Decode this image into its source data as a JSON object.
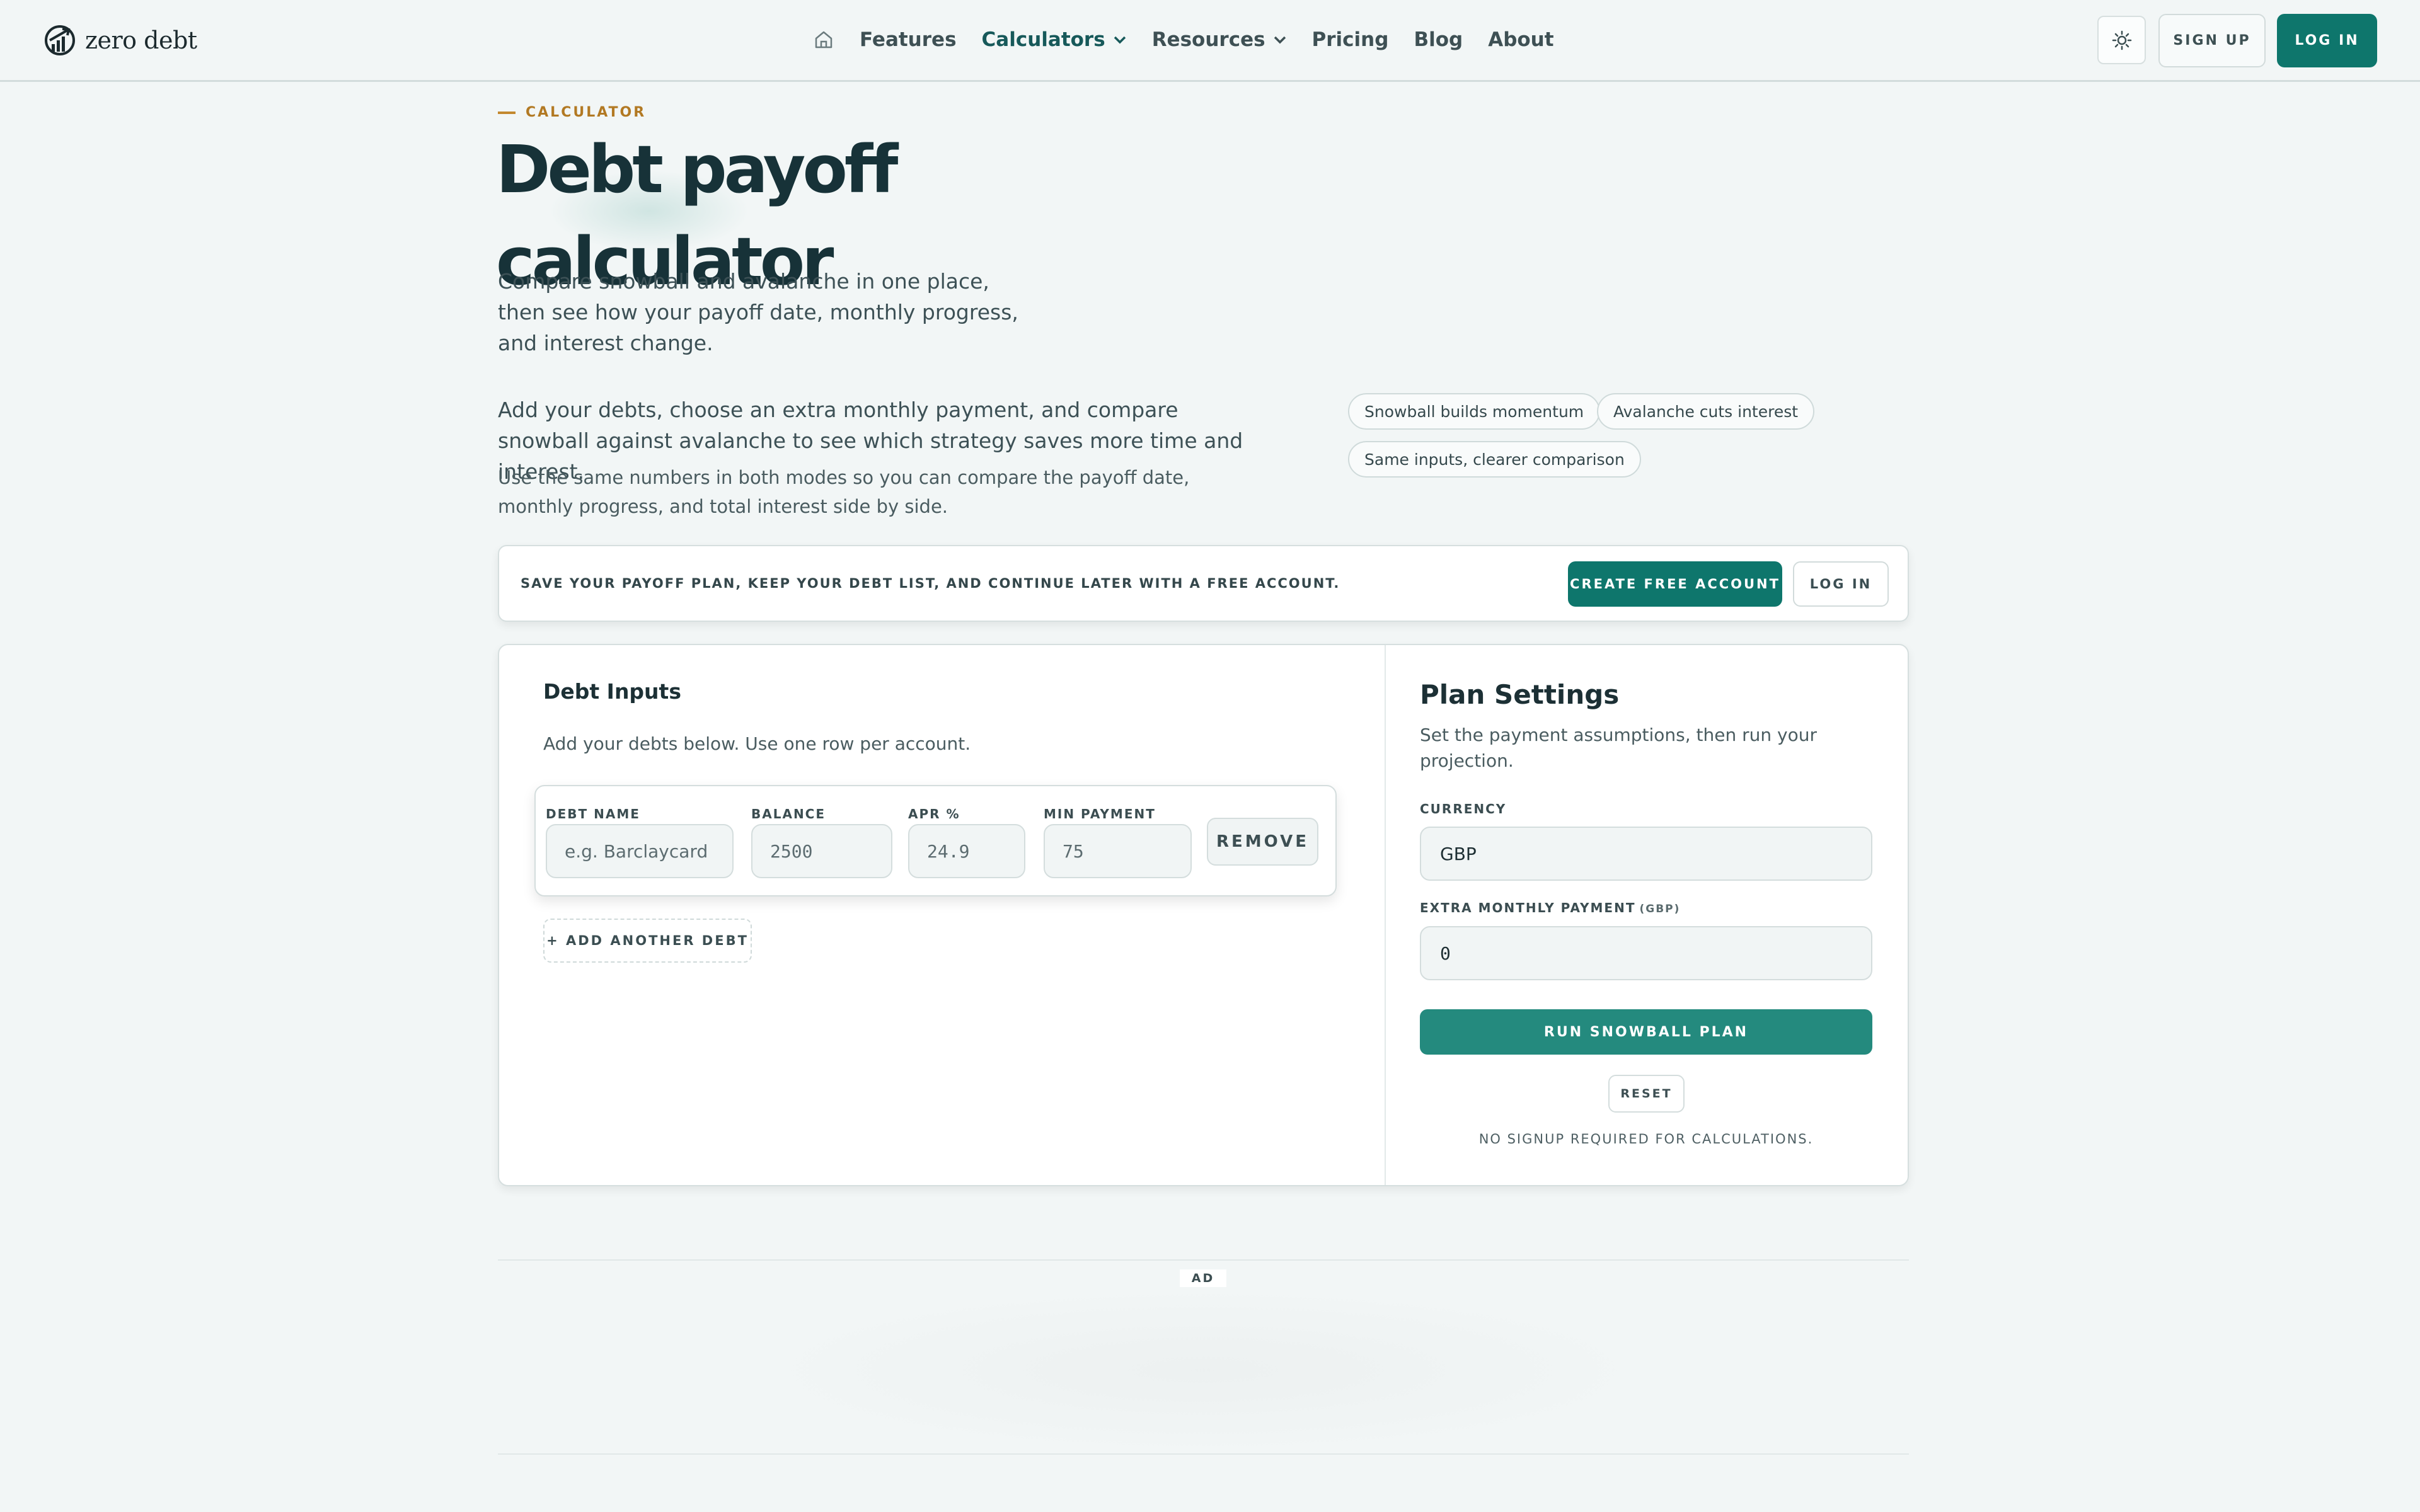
{
  "brand": {
    "name": "zero debt"
  },
  "nav": {
    "items": [
      {
        "label": "Features"
      },
      {
        "label": "Calculators"
      },
      {
        "label": "Resources"
      },
      {
        "label": "Pricing"
      },
      {
        "label": "Blog"
      },
      {
        "label": "About"
      }
    ],
    "active": "Calculators",
    "signup": "SIGN UP",
    "login": "LOG IN"
  },
  "hero": {
    "eyebrow": "CALCULATOR",
    "title_line1": "Debt payoff",
    "title_line2": "calculator",
    "lead": "Compare snowball and avalanche in one place, then see how your payoff date, monthly progress, and interest change.",
    "intro": "Add your debts, choose an extra monthly payment, and compare snowball against avalanche to see which strategy saves more time and interest.",
    "intro_secondary": "Use the same numbers in both modes so you can compare the payoff date, monthly progress, and total interest side by side.",
    "pills": [
      "Snowball builds momentum",
      "Avalanche cuts interest",
      "Same inputs, clearer comparison"
    ]
  },
  "save_banner": {
    "text": "SAVE YOUR PAYOFF PLAN, KEEP YOUR DEBT LIST, AND CONTINUE LATER WITH A FREE ACCOUNT.",
    "create": "CREATE FREE ACCOUNT",
    "login": "LOG IN"
  },
  "debt_inputs": {
    "title": "Debt Inputs",
    "subtitle": "Add your debts below. Use one row per account.",
    "columns": {
      "name": "DEBT NAME",
      "balance": "BALANCE",
      "apr": "APR %",
      "min_payment": "MIN PAYMENT"
    },
    "rows": [
      {
        "name_placeholder": "e.g. Barclaycard",
        "balance": "2500",
        "apr": "24.9",
        "min_payment": "75"
      }
    ],
    "remove": "REMOVE",
    "add": "+ ADD ANOTHER DEBT"
  },
  "plan_settings": {
    "title": "Plan Settings",
    "subtitle": "Set the payment assumptions, then run your projection.",
    "currency_label": "CURRENCY",
    "currency_value": "GBP",
    "extra_label": "EXTRA MONTHLY PAYMENT",
    "extra_unit": "(GBP)",
    "extra_value": "0",
    "run": "RUN SNOWBALL PLAN",
    "reset": "RESET",
    "note": "NO SIGNUP REQUIRED FOR CALCULATIONS."
  },
  "ad": {
    "label": "AD"
  },
  "colors": {
    "primary": "#0e766c",
    "accent": "#b27923",
    "text": "#173238",
    "background": "#f2f6f6"
  }
}
